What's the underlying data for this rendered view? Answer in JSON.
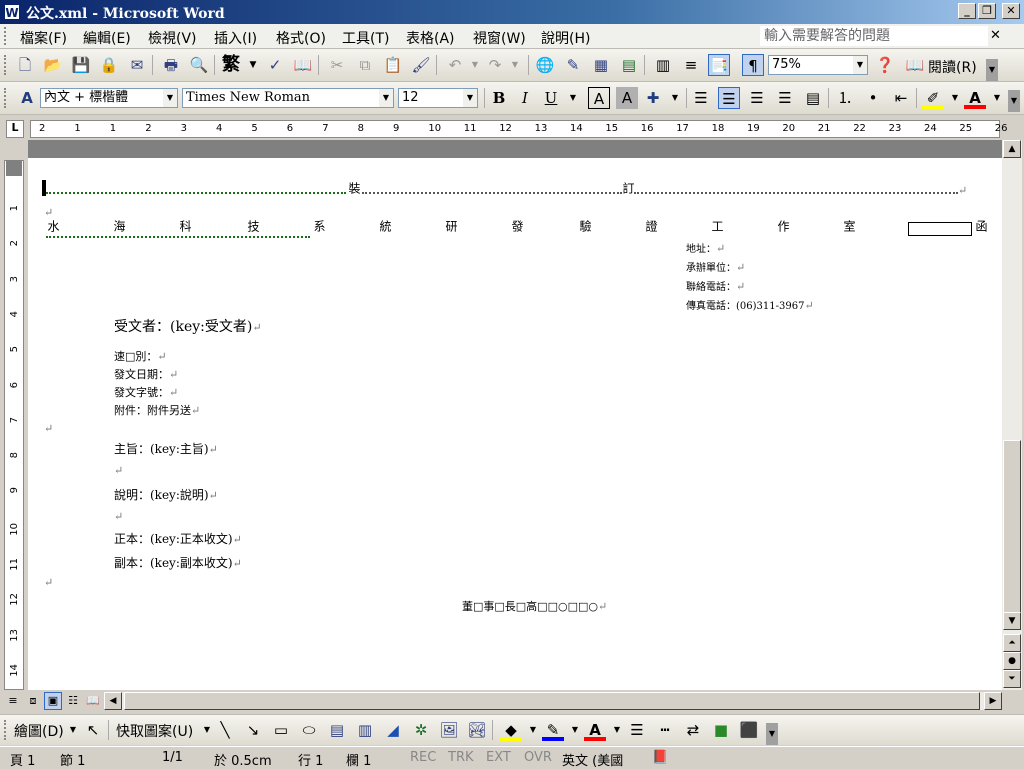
{
  "window": {
    "title": "公文.xml - Microsoft Word",
    "app_icon": "W"
  },
  "menu": {
    "items": [
      "檔案(F)",
      "編輯(E)",
      "檢視(V)",
      "插入(I)",
      "格式(O)",
      "工具(T)",
      "表格(A)",
      "視窗(W)",
      "說明(H)"
    ],
    "help_placeholder": "輸入需要解答的問題"
  },
  "standard_toolbar": {
    "traditional_label": "繁",
    "zoom": "75%",
    "read_label": "閱讀(R)"
  },
  "format_toolbar": {
    "style": "內文 + 標楷體",
    "font": "Times New Roman",
    "size": "12",
    "bold": "B",
    "italic": "I",
    "underline": "U",
    "char_border": "A",
    "char_shading": "A"
  },
  "ruler": {
    "left_tab": "L",
    "numbers": [
      "2",
      "1",
      "1",
      "2",
      "3",
      "4",
      "5",
      "6",
      "7",
      "8",
      "9",
      "10",
      "11",
      "12",
      "13",
      "14",
      "15",
      "16",
      "17",
      "18",
      "19",
      "20",
      "21",
      "22",
      "23",
      "24",
      "25",
      "26"
    ],
    "vnumbers": [
      "1",
      "2",
      "3",
      "4",
      "5",
      "6",
      "7",
      "8",
      "9",
      "10",
      "11",
      "12",
      "13",
      "14"
    ]
  },
  "document": {
    "binding_line_1": "裝",
    "binding_line_2": "訂",
    "agency": [
      "水",
      "海",
      "科",
      "技",
      "系",
      "統",
      "研",
      "發",
      "驗",
      "證",
      "工",
      "作",
      "室"
    ],
    "letter_type": "函",
    "address_label": "地址：",
    "contact_unit_label": "承辦單位：",
    "contact_phone_label": "聯絡電話：",
    "fax_label": "傳真電話：",
    "fax_number": "(06)311-3967",
    "recipient": "受文者：(key:受文者)",
    "speed_label": "速□別：",
    "date_label": "發文日期：",
    "doc_number_label": "發文字號：",
    "attachment_label": "附件：附件另送",
    "subject": "主旨：(key:主旨)",
    "explanation": "說明：(key:說明)",
    "main_copy": "正本：(key:正本收文)",
    "copy": "副本：(key:副本收文)",
    "signature": "董□事□長□高□□○□□○"
  },
  "drawing_toolbar": {
    "draw_label": "繪圖(D)",
    "autoshapes_label": "快取圖案(U)"
  },
  "status": {
    "page": "頁 1",
    "section": "節 1",
    "page_of": "1/1",
    "at": "於 0.5cm",
    "line": "行 1",
    "column": "欄 1",
    "rec": "REC",
    "trk": "TRK",
    "ext": "EXT",
    "ovr": "OVR",
    "language": "英文 (美國"
  }
}
